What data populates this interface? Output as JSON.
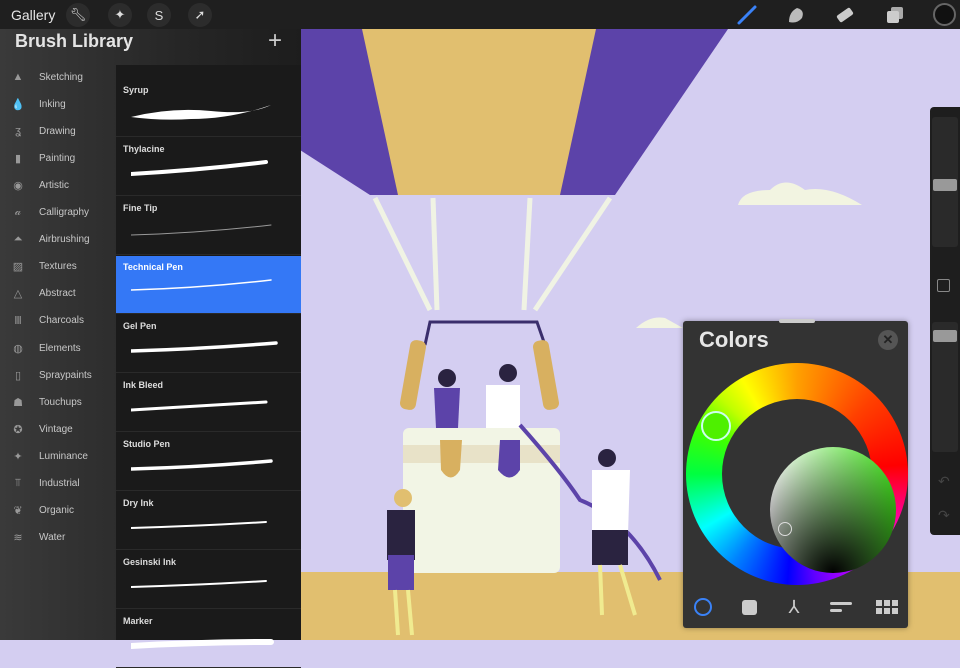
{
  "topbar": {
    "gallery": "Gallery",
    "left_tools": [
      "wrench-icon",
      "magic-wand-icon",
      "selection-icon",
      "transform-arrow-icon"
    ],
    "right_tools": [
      "brush-icon",
      "smudge-icon",
      "eraser-icon",
      "layers-icon",
      "color-swatch"
    ],
    "accent": "#3478f6"
  },
  "library": {
    "title": "Brush Library",
    "add": "+",
    "categories": [
      {
        "label": "Sketching",
        "icon": "▲"
      },
      {
        "label": "Inking",
        "icon": "💧"
      },
      {
        "label": "Drawing",
        "icon": "ʓ"
      },
      {
        "label": "Painting",
        "icon": "▮"
      },
      {
        "label": "Artistic",
        "icon": "◉"
      },
      {
        "label": "Calligraphy",
        "icon": "𝒶"
      },
      {
        "label": "Airbrushing",
        "icon": "⏶"
      },
      {
        "label": "Textures",
        "icon": "▨"
      },
      {
        "label": "Abstract",
        "icon": "△"
      },
      {
        "label": "Charcoals",
        "icon": "Ⅲ"
      },
      {
        "label": "Elements",
        "icon": "◍"
      },
      {
        "label": "Spraypaints",
        "icon": "▯"
      },
      {
        "label": "Touchups",
        "icon": "☗"
      },
      {
        "label": "Vintage",
        "icon": "✪"
      },
      {
        "label": "Luminance",
        "icon": "✦"
      },
      {
        "label": "Industrial",
        "icon": "⫪"
      },
      {
        "label": "Organic",
        "icon": "❦"
      },
      {
        "label": "Water",
        "icon": "≋"
      }
    ],
    "selected_category": "Inking",
    "brushes": [
      "Syrup",
      "Thylacine",
      "Fine Tip",
      "Technical Pen",
      "Gel Pen",
      "Ink Bleed",
      "Studio Pen",
      "Dry Ink",
      "Gesinski Ink",
      "Marker"
    ],
    "selected_brush": "Technical Pen"
  },
  "colors": {
    "title": "Colors",
    "close": "✕",
    "modes": [
      "disc",
      "classic",
      "harmony",
      "value",
      "palettes"
    ],
    "selected_hex": "#3fdd1a"
  }
}
